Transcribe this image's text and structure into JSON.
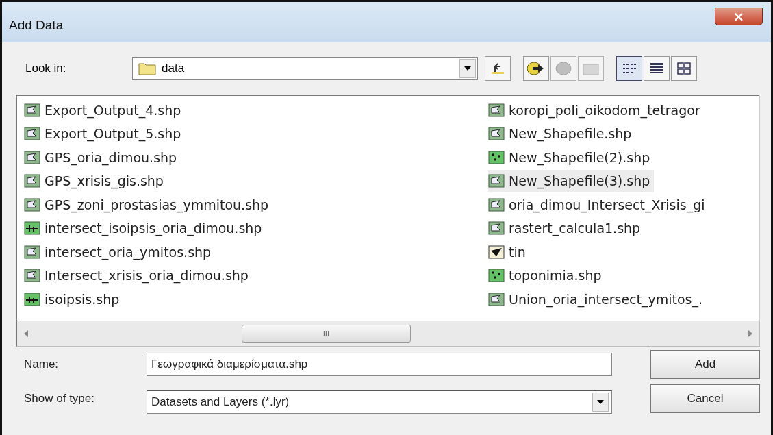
{
  "window": {
    "title": "Add Data",
    "close": "×"
  },
  "look_in": {
    "label": "Look in:",
    "value": "data"
  },
  "view_buttons": [
    {
      "kind": "list",
      "selected": true
    },
    {
      "kind": "details",
      "selected": false
    },
    {
      "kind": "thumbnails",
      "selected": false
    }
  ],
  "files": [
    {
      "name": "Export_Output_4.shp",
      "kind": "polygon",
      "selected": false
    },
    {
      "name": "Export_Output_5.shp",
      "kind": "polygon",
      "selected": false
    },
    {
      "name": "GPS_oria_dimou.shp",
      "kind": "polygon",
      "selected": false
    },
    {
      "name": "GPS_xrisis_gis.shp",
      "kind": "polygon",
      "selected": false
    },
    {
      "name": "GPS_zoni_prostasias_ymmitou.shp",
      "kind": "polygon",
      "selected": false
    },
    {
      "name": "intersect_isoipsis_oria_dimou.shp",
      "kind": "line",
      "selected": false
    },
    {
      "name": "intersect_oria_ymitos.shp",
      "kind": "polygon",
      "selected": false
    },
    {
      "name": "Intersect_xrisis_oria_dimou.shp",
      "kind": "polygon",
      "selected": false
    },
    {
      "name": "isoipsis.shp",
      "kind": "line",
      "selected": false
    },
    {
      "name": "koropi_poli_oikodom_tetragor",
      "kind": "polygon",
      "selected": false
    },
    {
      "name": "New_Shapefile.shp",
      "kind": "polygon",
      "selected": false
    },
    {
      "name": "New_Shapefile(2).shp",
      "kind": "point",
      "selected": false
    },
    {
      "name": "New_Shapefile(3).shp",
      "kind": "polygon",
      "selected": true
    },
    {
      "name": "oria_dimou_Intersect_Xrisis_gi",
      "kind": "polygon",
      "selected": false
    },
    {
      "name": "rastert_calcula1.shp",
      "kind": "polygon",
      "selected": false
    },
    {
      "name": "tin",
      "kind": "tin",
      "selected": false
    },
    {
      "name": "toponimia.shp",
      "kind": "point",
      "selected": false
    },
    {
      "name": "Union_oria_intersect_ymitos_.",
      "kind": "polygon",
      "selected": false
    }
  ],
  "scrollbar": {
    "grip": "III"
  },
  "name_field": {
    "label": "Name:",
    "value": "Γεωγραφικά διαμερίσματα.shp"
  },
  "type_field": {
    "label": "Show of type:",
    "value": "Datasets and Layers (*.lyr)"
  },
  "buttons": [
    "Add",
    "Cancel"
  ]
}
